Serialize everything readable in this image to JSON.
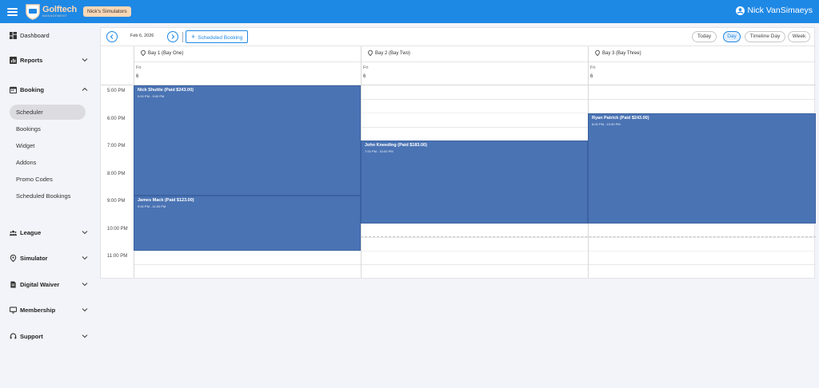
{
  "header": {
    "logo_primary": "Golftech",
    "logo_secondary": "MANAGEMENT",
    "org_badge": "Nick's Simulators",
    "user_name": "Nick VanSimaeys",
    "colors": {
      "bar": "#1e88e5",
      "badge": "#fbd8b6"
    }
  },
  "sidebar": {
    "dashboard": "Dashboard",
    "reports": "Reports",
    "booking": "Booking",
    "booking_sub": [
      "Scheduler",
      "Bookings",
      "Widget",
      "Addons",
      "Promo Codes",
      "Scheduled Bookings"
    ],
    "league": "League",
    "simulator": "Simulator",
    "digital_waiver": "Digital Waiver",
    "membership": "Membership",
    "support": "Support"
  },
  "toolbar": {
    "prev_icon": "chevron-left-icon",
    "next_icon": "chevron-right-icon",
    "date": "Feb 6, 2026",
    "scheduled_booking": "Scheduled Booking",
    "views": [
      "Today",
      "Day",
      "Timeline Day",
      "Week"
    ],
    "active_view": "Day"
  },
  "bays": [
    {
      "title": "Bay 1 (Bay One)",
      "dow": "Fri",
      "day": "6"
    },
    {
      "title": "Bay 2 (Bay Two)",
      "dow": "Fri",
      "day": "6"
    },
    {
      "title": "Bay 3 (Bay Three)",
      "dow": "Fri",
      "day": "6"
    }
  ],
  "times": [
    "5:00 PM",
    "6:00 PM",
    "7:00 PM",
    "8:00 PM",
    "9:00 PM",
    "10:00 PM",
    "11:00 PM"
  ],
  "events": [
    {
      "bay": 0,
      "start": 17,
      "end": 21,
      "title": "Nick Shuttle (Paid $243.00)",
      "time": "5:00 PM - 9:00 PM"
    },
    {
      "bay": 0,
      "start": 21,
      "end": 23,
      "title": "James Mack (Paid $123.00)",
      "time": "9:00 PM - 11:00 PM"
    },
    {
      "bay": 1,
      "start": 19,
      "end": 22,
      "title": "John Kneeding (Paid $183.00)",
      "time": "7:00 PM - 10:00 PM"
    },
    {
      "bay": 2,
      "start": 18,
      "end": 22,
      "title": "Ryan Patrick (Paid $243.00)",
      "time": "6:00 PM - 10:00 PM"
    }
  ],
  "event_color": "#4a73b4"
}
